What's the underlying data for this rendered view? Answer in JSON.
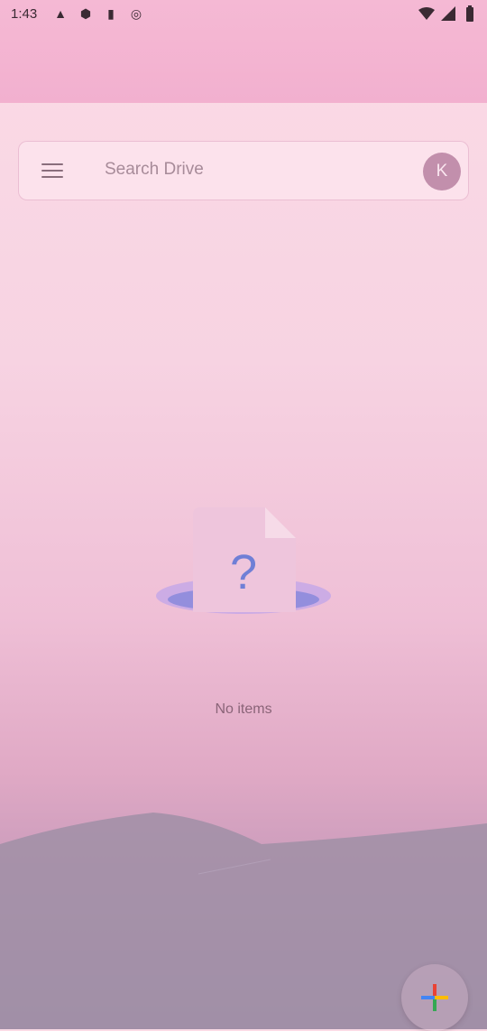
{
  "status_bar": {
    "time": "1:43"
  },
  "search": {
    "placeholder": "Search Drive",
    "avatar_letter": "K"
  },
  "empty_state": {
    "message": "No items"
  },
  "icons": {
    "menu": "hamburger-menu-icon",
    "fab": "plus-icon",
    "empty": "unknown-file-icon"
  },
  "colors": {
    "accent_blue": "#6f7fd6",
    "avatar_bg": "#c28fac"
  }
}
